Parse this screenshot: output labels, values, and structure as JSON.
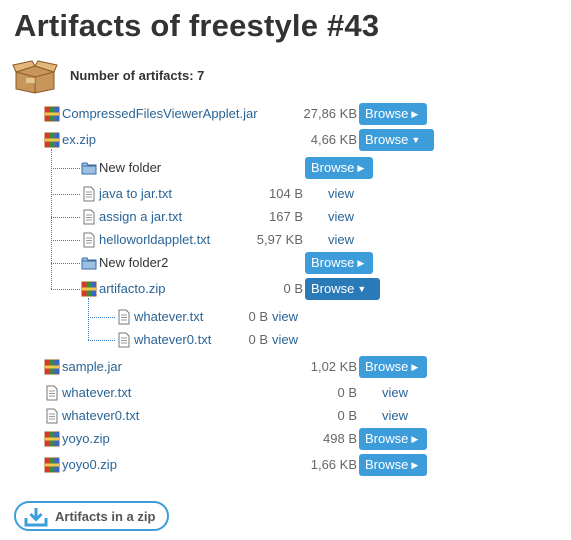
{
  "title": "Artifacts of freestyle #43",
  "count_label": "Number of artifacts: 7",
  "download_all_label": "Artifacts in a zip",
  "colors": {
    "button": "#3d9ddb",
    "button_active": "#2a7ab8",
    "link": "#2a6496"
  },
  "items": [
    {
      "name": "CompressedFilesViewerApplet.jar",
      "size": "27,86 KB",
      "action": "Browse",
      "icon": "archive-icon"
    },
    {
      "name": "ex.zip",
      "size": "4,66 KB",
      "action": "Browse",
      "icon": "archive-icon",
      "expanded": true,
      "children": [
        {
          "name": "New folder",
          "action": "Browse",
          "icon": "folder-icon"
        },
        {
          "name": "java to jar.txt",
          "size": "104 B",
          "action": "view",
          "icon": "text-file-icon"
        },
        {
          "name": "assign a jar.txt",
          "size": "167 B",
          "action": "view",
          "icon": "text-file-icon"
        },
        {
          "name": "helloworldapplet.txt",
          "size": "5,97 KB",
          "action": "view",
          "icon": "text-file-icon"
        },
        {
          "name": "New folder2",
          "action": "Browse",
          "icon": "folder-icon"
        },
        {
          "name": "artifacto.zip",
          "size": "0 B",
          "action": "Browse",
          "icon": "archive-icon",
          "expanded": true,
          "children": [
            {
              "name": "whatever.txt",
              "size": "0 B",
              "action": "view",
              "icon": "text-file-icon"
            },
            {
              "name": "whatever0.txt",
              "size": "0 B",
              "action": "view",
              "icon": "text-file-icon"
            }
          ]
        }
      ]
    },
    {
      "name": "sample.jar",
      "size": "1,02 KB",
      "action": "Browse",
      "icon": "archive-icon"
    },
    {
      "name": "whatever.txt",
      "size": "0 B",
      "action": "view",
      "icon": "text-file-icon"
    },
    {
      "name": "whatever0.txt",
      "size": "0 B",
      "action": "view",
      "icon": "text-file-icon"
    },
    {
      "name": "yoyo.zip",
      "size": "498 B",
      "action": "Browse",
      "icon": "archive-icon"
    },
    {
      "name": "yoyo0.zip",
      "size": "1,66 KB",
      "action": "Browse",
      "icon": "archive-icon"
    }
  ]
}
